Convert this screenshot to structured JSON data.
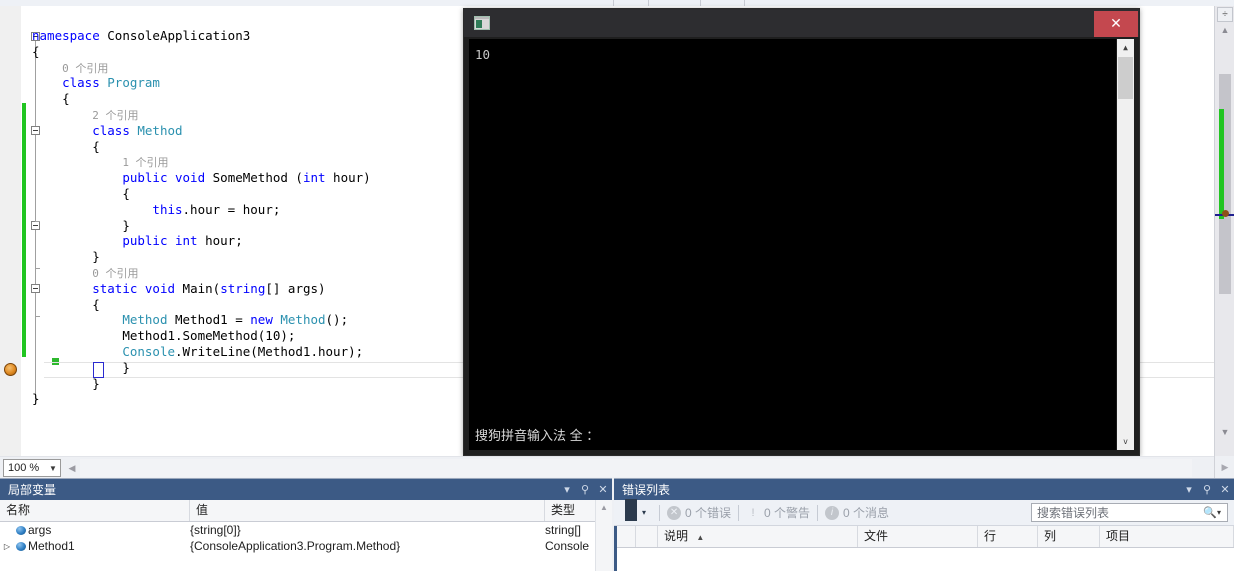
{
  "editor": {
    "zoom_level": "100 %",
    "code_lines": [
      {
        "indent": 0,
        "segments": [
          {
            "t": "namespace ",
            "c": "kw"
          },
          {
            "t": "ConsoleApplication3",
            "c": "plain"
          }
        ]
      },
      {
        "indent": 0,
        "segments": [
          {
            "t": "{",
            "c": "plain"
          }
        ]
      },
      {
        "indent": 1,
        "segments": [
          {
            "t": "0 个引用",
            "c": "ref"
          }
        ]
      },
      {
        "indent": 1,
        "segments": [
          {
            "t": "class ",
            "c": "kw"
          },
          {
            "t": "Program",
            "c": "type"
          }
        ]
      },
      {
        "indent": 1,
        "segments": [
          {
            "t": "{",
            "c": "plain"
          }
        ]
      },
      {
        "indent": 2,
        "segments": [
          {
            "t": "2 个引用",
            "c": "ref"
          }
        ]
      },
      {
        "indent": 2,
        "segments": [
          {
            "t": "class ",
            "c": "kw"
          },
          {
            "t": "Method",
            "c": "type"
          }
        ]
      },
      {
        "indent": 2,
        "segments": [
          {
            "t": "{",
            "c": "plain"
          }
        ]
      },
      {
        "indent": 3,
        "segments": [
          {
            "t": "1 个引用",
            "c": "ref"
          }
        ]
      },
      {
        "indent": 3,
        "segments": [
          {
            "t": "public ",
            "c": "kw"
          },
          {
            "t": "void ",
            "c": "kw"
          },
          {
            "t": "SomeMethod (",
            "c": "plain"
          },
          {
            "t": "int",
            "c": "kw"
          },
          {
            "t": " hour)",
            "c": "plain"
          }
        ]
      },
      {
        "indent": 3,
        "segments": [
          {
            "t": "{",
            "c": "plain"
          }
        ]
      },
      {
        "indent": 4,
        "segments": [
          {
            "t": "this",
            "c": "kw"
          },
          {
            "t": ".hour = hour;",
            "c": "plain"
          }
        ]
      },
      {
        "indent": 3,
        "segments": [
          {
            "t": "}",
            "c": "plain"
          }
        ]
      },
      {
        "indent": 3,
        "segments": [
          {
            "t": "public ",
            "c": "kw"
          },
          {
            "t": "int ",
            "c": "kw"
          },
          {
            "t": "hour;",
            "c": "plain"
          }
        ]
      },
      {
        "indent": 2,
        "segments": [
          {
            "t": "}",
            "c": "plain"
          }
        ]
      },
      {
        "indent": 2,
        "segments": [
          {
            "t": "0 个引用",
            "c": "ref"
          }
        ]
      },
      {
        "indent": 2,
        "segments": [
          {
            "t": "static ",
            "c": "kw"
          },
          {
            "t": "void ",
            "c": "kw"
          },
          {
            "t": "Main(",
            "c": "plain"
          },
          {
            "t": "string",
            "c": "kw"
          },
          {
            "t": "[] args)",
            "c": "plain"
          }
        ]
      },
      {
        "indent": 2,
        "segments": [
          {
            "t": "{",
            "c": "plain"
          }
        ]
      },
      {
        "indent": 3,
        "segments": [
          {
            "t": "Method",
            "c": "type"
          },
          {
            "t": " Method1 = ",
            "c": "plain"
          },
          {
            "t": "new ",
            "c": "kw"
          },
          {
            "t": "Method",
            "c": "type"
          },
          {
            "t": "();",
            "c": "plain"
          }
        ]
      },
      {
        "indent": 3,
        "segments": [
          {
            "t": "Method1.SomeMethod(10);",
            "c": "plain"
          }
        ]
      },
      {
        "indent": 3,
        "segments": [
          {
            "t": "Console",
            "c": "type"
          },
          {
            "t": ".WriteLine(Method1.hour);",
            "c": "plain"
          }
        ]
      },
      {
        "indent": 3,
        "segments": [
          {
            "t": "}",
            "c": "plain"
          }
        ]
      },
      {
        "indent": 2,
        "segments": [
          {
            "t": "}",
            "c": "plain"
          }
        ]
      },
      {
        "indent": 0,
        "segments": [
          {
            "t": "}",
            "c": "plain"
          }
        ]
      }
    ]
  },
  "console_window": {
    "title": "",
    "close_label": "✕",
    "output": "10",
    "ime_status": "搜狗拼音输入法 全 ："
  },
  "locals_panel": {
    "title": "局部变量",
    "columns": [
      "名称",
      "值",
      "类型"
    ],
    "rows": [
      {
        "expandable": false,
        "name": "args",
        "value": "{string[0]}",
        "type": "string[]"
      },
      {
        "expandable": true,
        "name": "Method1",
        "value": "{ConsoleApplication3.Program.Method}",
        "type": "Console"
      }
    ],
    "dropdown_label": "▾",
    "pin_label": "⚲",
    "close_label": "✕"
  },
  "error_list_panel": {
    "title": "错误列表",
    "dropdown_label": "▾",
    "pin_label": "⚲",
    "close_label": "✕",
    "filter_caret": "▾",
    "counts": [
      {
        "icon": "error-icon",
        "label": "0 个错误",
        "glyph": "✕"
      },
      {
        "icon": "warning-icon",
        "label": "0 个警告",
        "glyph": "!"
      },
      {
        "icon": "info-icon",
        "label": "0 个消息",
        "glyph": "i"
      }
    ],
    "search_placeholder": "搜索错误列表",
    "search_icon": "🔍",
    "search_caret": "▾",
    "columns": [
      "说明",
      "文件",
      "行",
      "列",
      "项目"
    ],
    "sort_indicator": "▲"
  },
  "scroll": {
    "split_glyph": "÷",
    "up_glyph": "▲",
    "down_glyph": "▼",
    "left_glyph": "◀",
    "right_glyph": "▶"
  },
  "colors": {
    "panel_header": "#3c5a85",
    "change_bar_green": "#21c521",
    "close_red": "#c4484f",
    "keyword_blue": "#0000ff",
    "type_teal": "#2b91af"
  }
}
